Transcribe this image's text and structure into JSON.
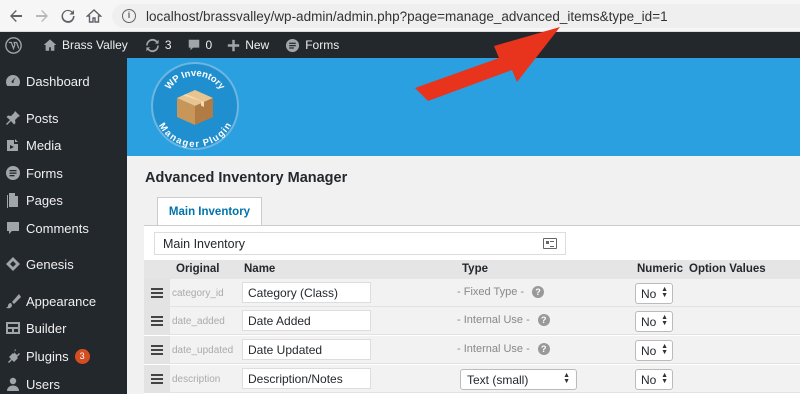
{
  "browser": {
    "url": "localhost/brassvalley/wp-admin/admin.php?page=manage_advanced_items&type_id=1"
  },
  "admin_bar": {
    "site_name": "Brass Valley",
    "updates_count": "3",
    "comments_count": "0",
    "new_label": "New",
    "forms_label": "Forms"
  },
  "sidebar": {
    "items": [
      {
        "label": "Dashboard",
        "icon": "dashboard-icon"
      },
      {
        "label": "Posts",
        "icon": "pin-icon"
      },
      {
        "label": "Media",
        "icon": "media-icon"
      },
      {
        "label": "Forms",
        "icon": "forms-icon"
      },
      {
        "label": "Pages",
        "icon": "pages-icon"
      },
      {
        "label": "Comments",
        "icon": "comment-icon"
      },
      {
        "label": "Genesis",
        "icon": "genesis-icon"
      },
      {
        "label": "Appearance",
        "icon": "brush-icon"
      },
      {
        "label": "Builder",
        "icon": "builder-icon"
      },
      {
        "label": "Plugins",
        "icon": "plugin-icon",
        "badge": "3"
      },
      {
        "label": "Users",
        "icon": "user-icon"
      }
    ]
  },
  "banner": {
    "logo_text_top": "WP Inventory",
    "logo_text_bottom": "Manager Plugin"
  },
  "main": {
    "title": "Advanced Inventory Manager",
    "tab_label": "Main Inventory",
    "inventory_name": "Main Inventory",
    "columns": [
      "Original",
      "Name",
      "Type",
      "Numeric",
      "Option Values"
    ],
    "rows": [
      {
        "original": "category_id",
        "name": "Category (Class)",
        "type": "- Fixed Type -",
        "numeric": "No"
      },
      {
        "original": "date_added",
        "name": "Date Added",
        "type": "- Internal Use -",
        "numeric": "No"
      },
      {
        "original": "date_updated",
        "name": "Date Updated",
        "type": "- Internal Use -",
        "numeric": "No"
      },
      {
        "original": "description",
        "name": "Description/Notes",
        "type_select": "Text (small)",
        "numeric": "No"
      }
    ]
  },
  "colors": {
    "admin_bar": "#23282d",
    "banner": "#2aa0e0",
    "link": "#0073aa",
    "arrow": "#e8341c",
    "badge": "#d54e21"
  }
}
